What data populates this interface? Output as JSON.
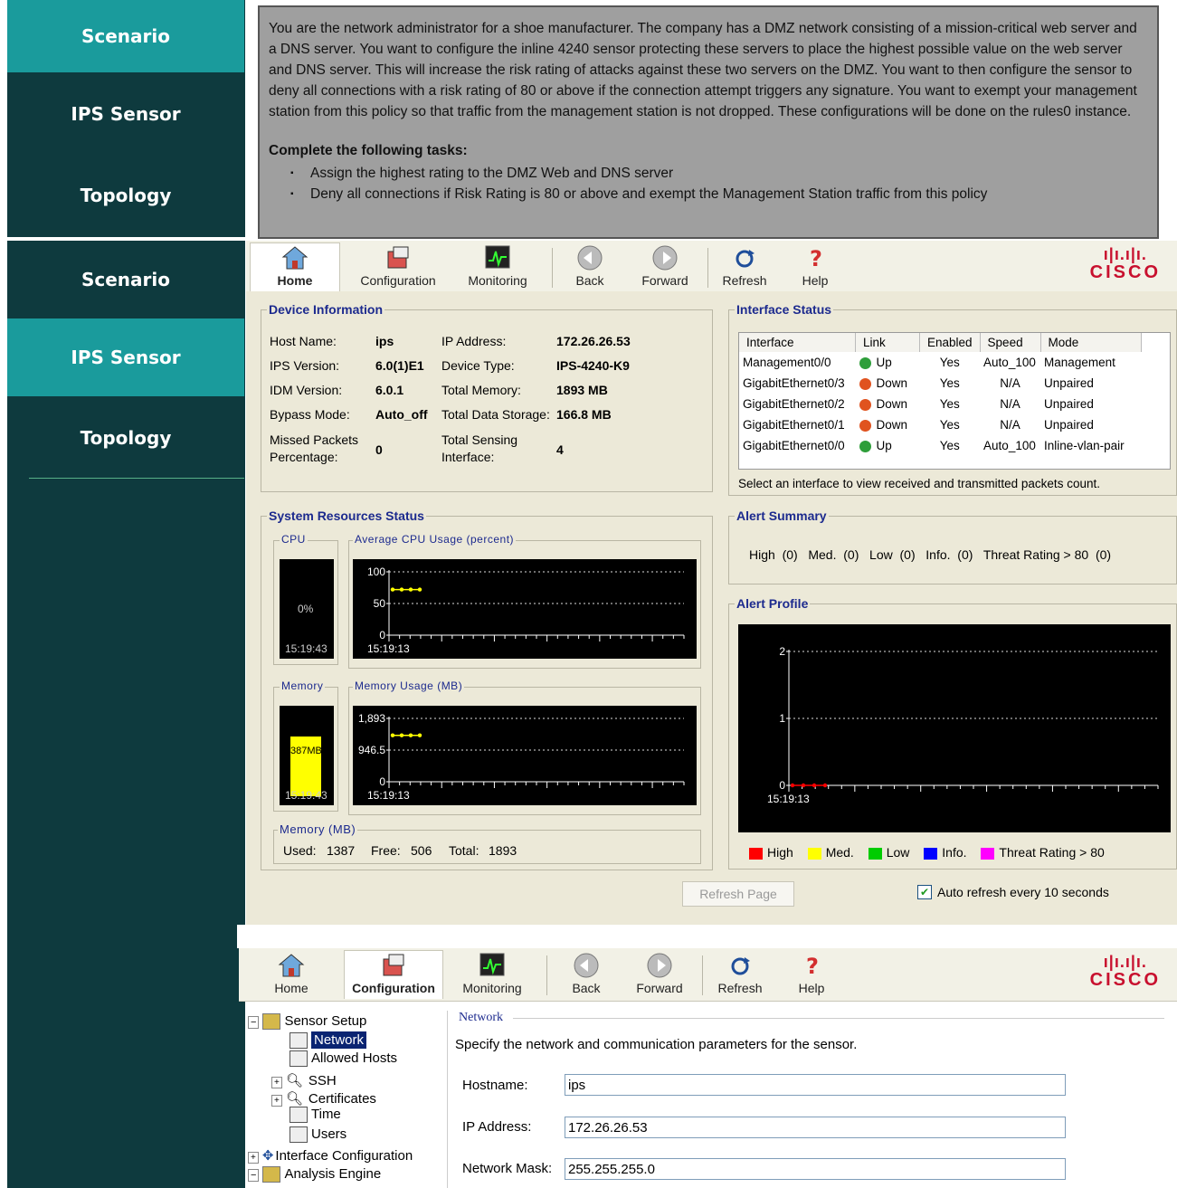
{
  "nav_top": {
    "scenario": "Scenario",
    "ips_sensor": "IPS Sensor",
    "topology": "Topology"
  },
  "nav_bottom": {
    "scenario": "Scenario",
    "ips_sensor": "IPS Sensor",
    "topology": "Topology"
  },
  "scenario": {
    "paragraph": "You are the network administrator for a shoe manufacturer. The company has a DMZ network consisting of a mission-critical web server and a DNS server. You want to configure the inline 4240 sensor protecting these servers to place the highest possible value on the web server and DNS server. This will increase the risk rating of attacks against these two servers on the DMZ. You want to then configure the sensor to deny all connections with a risk rating of 80 or above if the connection attempt triggers any signature. You want to exempt your management station from this policy so that traffic from the management station is not dropped. These configurations will be done on the rules0 instance.",
    "tasks_title": "Complete the following tasks:",
    "tasks": [
      "Assign the highest rating to the DMZ Web and DNS server",
      "Deny all connections if Risk Rating is 80 or above and exempt the Management Station traffic from this policy"
    ]
  },
  "toolbar": {
    "home": "Home",
    "configuration": "Configuration",
    "monitoring": "Monitoring",
    "back": "Back",
    "forward": "Forward",
    "refresh": "Refresh",
    "help": "Help",
    "logo": "CISCO"
  },
  "device_info": {
    "title": "Device Information",
    "host_name_label": "Host Name:",
    "host_name": "ips",
    "ips_version_label": "IPS Version:",
    "ips_version": "6.0(1)E1",
    "idm_version_label": "IDM Version:",
    "idm_version": "6.0.1",
    "bypass_mode_label": "Bypass Mode:",
    "bypass_mode": "Auto_off",
    "missed_packets_label_1": "Missed Packets",
    "missed_packets_label_2": "Percentage:",
    "missed_packets": "0",
    "ip_address_label": "IP Address:",
    "ip_address": "172.26.26.53",
    "device_type_label": "Device Type:",
    "device_type": "IPS-4240-K9",
    "total_memory_label": "Total Memory:",
    "total_memory": "1893 MB",
    "total_storage_label": "Total Data Storage:",
    "total_storage": "166.8 MB",
    "sensing_label_1": "Total Sensing",
    "sensing_label_2": "Interface:",
    "sensing": "4"
  },
  "interface_status": {
    "title": "Interface Status",
    "columns": [
      "Interface",
      "Link",
      "Enabled",
      "Speed",
      "Mode"
    ],
    "rows": [
      {
        "interface": "Management0/0",
        "link": "Up",
        "enabled": "Yes",
        "speed": "Auto_100",
        "mode": "Management"
      },
      {
        "interface": "GigabitEthernet0/3",
        "link": "Down",
        "enabled": "Yes",
        "speed": "N/A",
        "mode": "Unpaired"
      },
      {
        "interface": "GigabitEthernet0/2",
        "link": "Down",
        "enabled": "Yes",
        "speed": "N/A",
        "mode": "Unpaired"
      },
      {
        "interface": "GigabitEthernet0/1",
        "link": "Down",
        "enabled": "Yes",
        "speed": "N/A",
        "mode": "Unpaired"
      },
      {
        "interface": "GigabitEthernet0/0",
        "link": "Up",
        "enabled": "Yes",
        "speed": "Auto_100",
        "mode": "Inline-vlan-pair"
      }
    ],
    "hint": "Select an interface to view received and transmitted packets count."
  },
  "system_resources": {
    "title": "System Resources Status",
    "cpu_label": "CPU",
    "cpu_value": "0%",
    "cpu_time": "15:19:43",
    "avg_cpu_label": "Average CPU Usage (percent)",
    "memory_label": "Memory",
    "memory_value": "387MB",
    "memory_time": "15:19:43",
    "memory_usage_label": "Memory Usage (MB)",
    "memory_mb_label": "Memory (MB)",
    "used_label": "Used:",
    "used": "1387",
    "free_label": "Free:",
    "free": "506",
    "total_label": "Total:",
    "total": "1893"
  },
  "alert_summary": {
    "title": "Alert Summary",
    "text": "High  (0)   Med.  (0)   Low  (0)   Info.  (0)   Threat Rating > 80  (0)"
  },
  "alert_profile": {
    "title": "Alert Profile",
    "legend": [
      {
        "label": "High",
        "color": "#ff0000"
      },
      {
        "label": "Med.",
        "color": "#ffff00"
      },
      {
        "label": "Low",
        "color": "#00cc00"
      },
      {
        "label": "Info.",
        "color": "#0000ff"
      },
      {
        "label": "Threat Rating > 80",
        "color": "#ff00ff"
      }
    ]
  },
  "footer": {
    "refresh_page": "Refresh Page",
    "auto_refresh": "Auto refresh every 10 seconds"
  },
  "chart_data": [
    {
      "type": "line",
      "title": "Average CPU Usage (percent)",
      "ylim": [
        0,
        100
      ],
      "y_ticks": [
        "100",
        "50",
        "0"
      ],
      "x_tick_labels": [
        "15:19:13"
      ],
      "series": [
        {
          "values": [
            72,
            72,
            72,
            72
          ]
        }
      ]
    },
    {
      "type": "line",
      "title": "Memory Usage (MB)",
      "ylim": [
        0,
        1893
      ],
      "y_ticks": [
        "1,893",
        "946.5",
        "0"
      ],
      "x_tick_labels": [
        "15:19:13"
      ],
      "series": [
        {
          "values": [
            1387,
            1387,
            1387,
            1387
          ]
        }
      ]
    },
    {
      "type": "line",
      "title": "Alert Profile",
      "ylim": [
        0,
        2
      ],
      "y_ticks": [
        "2",
        "1",
        "0"
      ],
      "x_tick_labels": [
        "15:19:13"
      ],
      "series": [
        {
          "values": [
            0,
            0,
            0,
            0
          ]
        }
      ]
    }
  ],
  "config": {
    "tree": {
      "sensor_setup": "Sensor Setup",
      "network": "Network",
      "allowed_hosts": "Allowed Hosts",
      "ssh": "SSH",
      "certificates": "Certificates",
      "time": "Time",
      "users": "Users",
      "interface_configuration": "Interface Configuration",
      "analysis_engine": "Analysis Engine"
    },
    "network_title": "Network",
    "description": "Specify the network and communication parameters for the sensor.",
    "hostname_label": "Hostname:",
    "hostname": "ips",
    "ip_label": "IP Address:",
    "ip": "172.26.26.53",
    "mask_label": "Network Mask:",
    "mask": "255.255.255.0"
  }
}
